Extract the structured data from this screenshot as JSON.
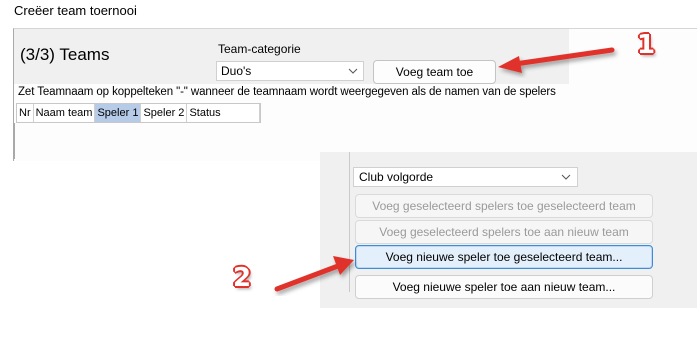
{
  "window": {
    "title": "Creëer team toernooi"
  },
  "teams": {
    "heading": "(3/3) Teams",
    "category_label": "Team-categorie",
    "category_value": "Duo's",
    "add_team_label": "Voeg team toe",
    "hint": "Zet Teamnaam op koppelteken \"-\" wanneer de teamnaam wordt weergegeven als de namen van de spelers",
    "columns": [
      "Nr",
      "Naam team",
      "Speler 1",
      "Speler 2",
      "Status"
    ]
  },
  "players": {
    "order_value": "Club volgorde",
    "buttons": [
      {
        "label": "Voeg geselecteerd spelers toe geselecteerd team",
        "state": "disabled"
      },
      {
        "label": "Voeg geselecteerd spelers toe aan nieuw team",
        "state": "disabled"
      },
      {
        "label": "Voeg nieuwe speler toe geselecteerd team...",
        "state": "focused"
      },
      {
        "label": "Voeg nieuwe speler toe aan nieuw team...",
        "state": "enabled"
      }
    ]
  },
  "annotations": {
    "marker_1": "1",
    "marker_2": "2",
    "color": "#e0322a"
  },
  "icons": {
    "select_chevron": "chevron-down-icon"
  }
}
